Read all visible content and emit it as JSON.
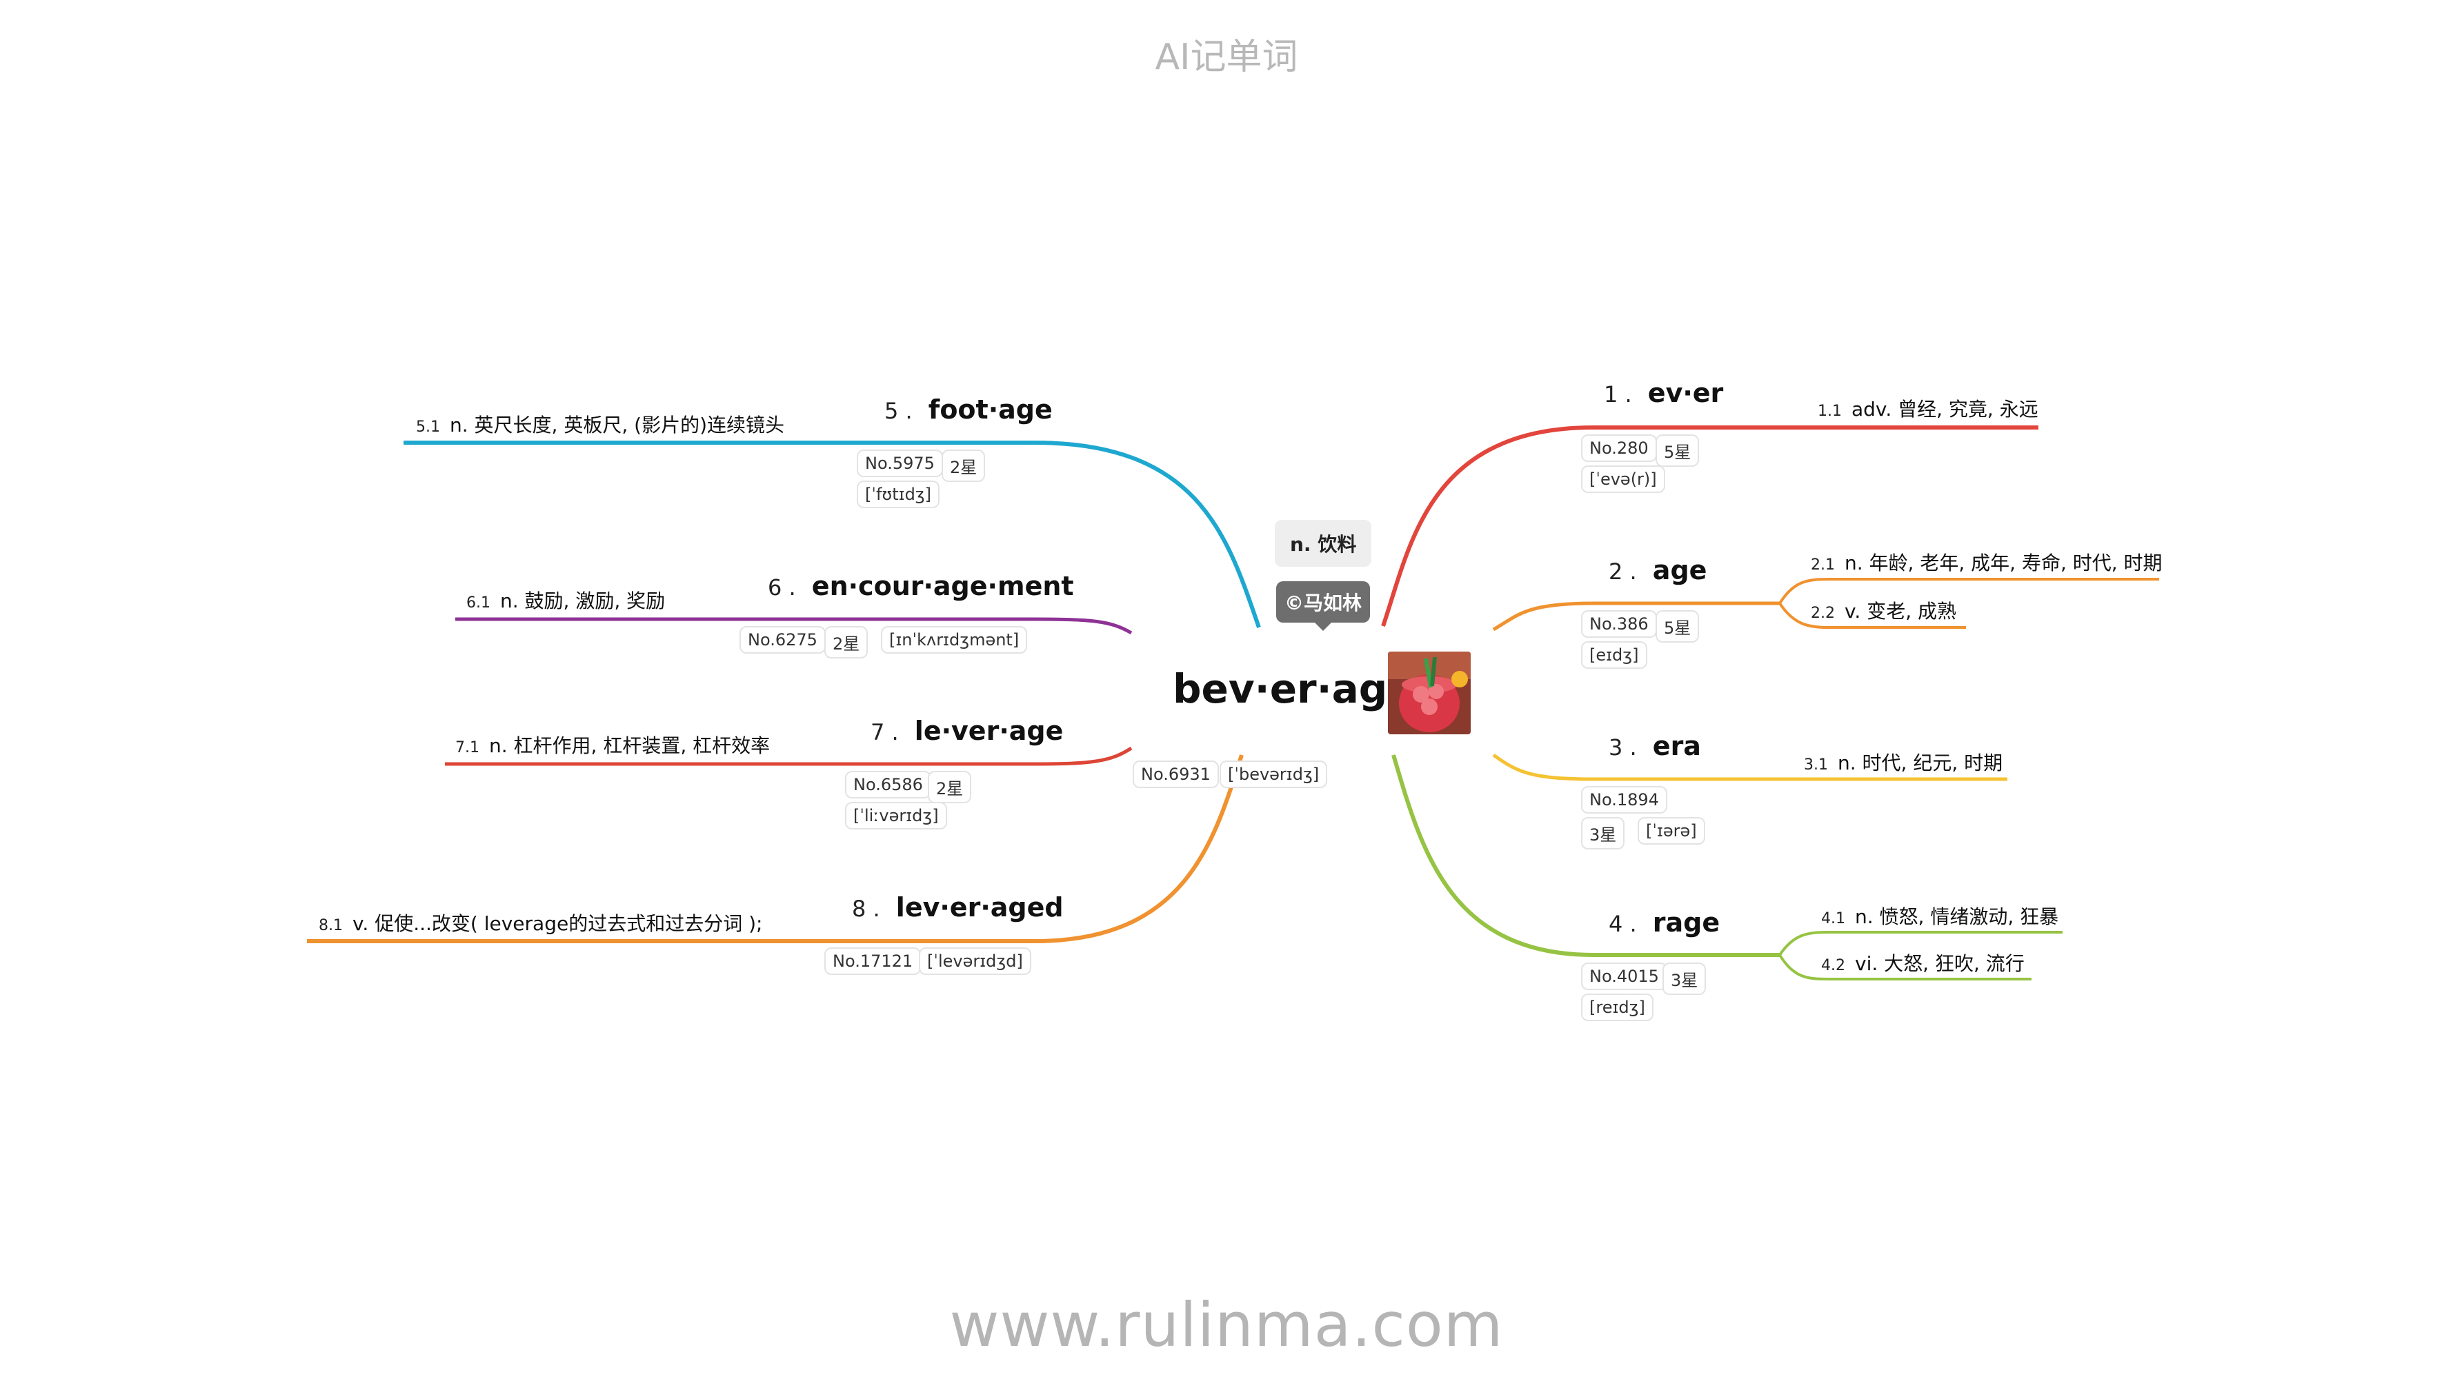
{
  "app_title": "AI记单词",
  "footer": "www.rulinma.com",
  "center": {
    "word": "bev·er·age",
    "meaning": "n. 饮料",
    "author": "©马如林",
    "rank": "No.6931",
    "phonetic": "[ˈbevərɪdʒ]",
    "image_icon": "cocktail-drink-image"
  },
  "branches": [
    {
      "num": "1 .",
      "word": "ev·er",
      "color": "#e2453c",
      "tags": [
        "No.280",
        "5星",
        "[ˈevə(r)]"
      ],
      "defs": [
        {
          "num": "1.1",
          "text": "adv. 曾经, 究竟, 永远"
        }
      ]
    },
    {
      "num": "2 .",
      "word": "age",
      "color": "#f0922f",
      "tags": [
        "No.386",
        "5星",
        "[eɪdʒ]"
      ],
      "defs": [
        {
          "num": "2.1",
          "text": "n. 年龄, 老年, 成年, 寿命, 时代, 时期"
        },
        {
          "num": "2.2",
          "text": "v. 变老, 成熟"
        }
      ]
    },
    {
      "num": "3 .",
      "word": "era",
      "color": "#f5c233",
      "tags": [
        "No.1894",
        "3星",
        "[ˈɪərə]"
      ],
      "defs": [
        {
          "num": "3.1",
          "text": "n. 时代, 纪元, 时期"
        }
      ]
    },
    {
      "num": "4 .",
      "word": "rage",
      "color": "#96c343",
      "tags": [
        "No.4015",
        "3星",
        "[reɪdʒ]"
      ],
      "defs": [
        {
          "num": "4.1",
          "text": "n. 愤怒, 情绪激动, 狂暴"
        },
        {
          "num": "4.2",
          "text": "vi. 大怒, 狂吹, 流行"
        }
      ]
    },
    {
      "num": "5 .",
      "word": "foot·age",
      "color": "#1ea8cf",
      "tags": [
        "No.5975",
        "2星",
        "[ˈfʊtɪdʒ]"
      ],
      "defs": [
        {
          "num": "5.1",
          "text": "n. 英尺长度, 英板尺, (影片的)连续镜头"
        }
      ]
    },
    {
      "num": "6 .",
      "word": "en·cour·age·ment",
      "color": "#8e3296",
      "tags": [
        "No.6275",
        "2星",
        "[ɪnˈkʌrɪdʒmənt]"
      ],
      "defs": [
        {
          "num": "6.1",
          "text": "n. 鼓励, 激励, 奖励"
        }
      ]
    },
    {
      "num": "7 .",
      "word": "le·ver·age",
      "color": "#dd4535",
      "tags": [
        "No.6586",
        "2星",
        "[ˈliːvərɪdʒ]"
      ],
      "defs": [
        {
          "num": "7.1",
          "text": "n. 杠杆作用, 杠杆装置, 杠杆效率"
        }
      ]
    },
    {
      "num": "8 .",
      "word": "lev·er·aged",
      "color": "#f0922f",
      "tags": [
        "No.17121",
        "[ˈlevərɪdʒd]"
      ],
      "defs": [
        {
          "num": "8.1",
          "text": "v. 促使...改变( leverage的过去式和过去分词 );"
        }
      ]
    }
  ]
}
